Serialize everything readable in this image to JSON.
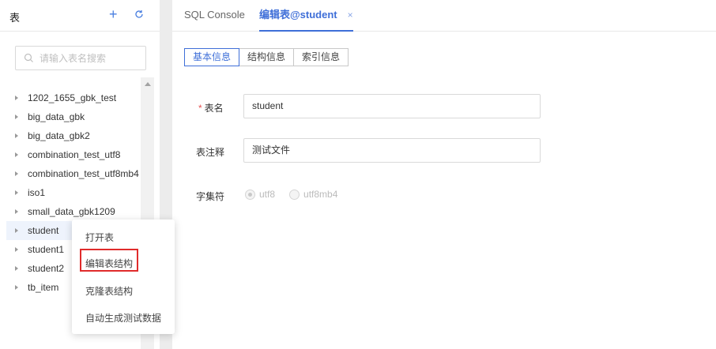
{
  "sidebar": {
    "title": "表",
    "add_label": "+",
    "search": {
      "placeholder": "请输入表名搜索",
      "value": ""
    },
    "tables": [
      {
        "name": "1202_1655_gbk_test"
      },
      {
        "name": "big_data_gbk"
      },
      {
        "name": "big_data_gbk2"
      },
      {
        "name": "combination_test_utf8"
      },
      {
        "name": "combination_test_utf8mb4"
      },
      {
        "name": "iso1"
      },
      {
        "name": "small_data_gbk1209"
      },
      {
        "name": "student"
      },
      {
        "name": "student1"
      },
      {
        "name": "student2"
      },
      {
        "name": "tb_item"
      }
    ],
    "selected": "student"
  },
  "context_menu": {
    "items": [
      {
        "label": "打开表"
      },
      {
        "label": "编辑表结构"
      },
      {
        "label": "克隆表结构"
      },
      {
        "label": "自动生成测试数据"
      }
    ],
    "highlighted": "编辑表结构"
  },
  "tabs": [
    {
      "label": "SQL Console"
    },
    {
      "label": "编辑表@student",
      "close": "×"
    }
  ],
  "subtabs": [
    {
      "label": "基本信息"
    },
    {
      "label": "结构信息"
    },
    {
      "label": "索引信息"
    }
  ],
  "form": {
    "required_mark": "*",
    "table_name_label": "表名",
    "table_name_value": "student",
    "comment_label": "表注释",
    "comment_value": "测试文件",
    "charset_label": "字集符",
    "charset_options": [
      {
        "label": "utf8"
      },
      {
        "label": "utf8mb4"
      }
    ],
    "charset_selected": "utf8"
  },
  "colors": {
    "accent": "#3f6fd8",
    "highlight_box": "#e02b2b",
    "required": "#e45050"
  }
}
